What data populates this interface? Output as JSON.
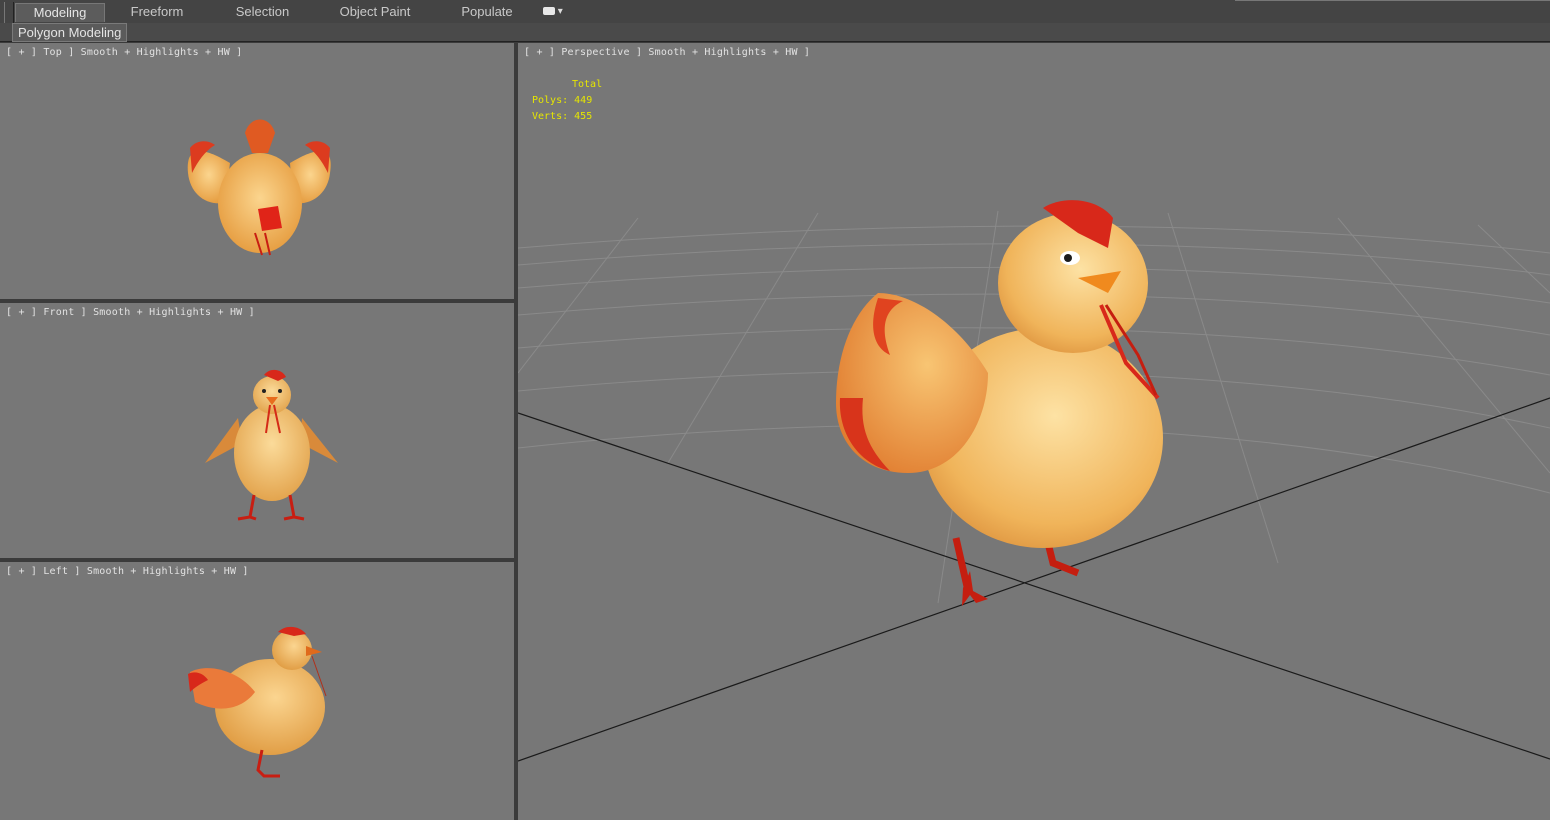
{
  "ribbon": {
    "tabs": [
      {
        "label": "Modeling",
        "active": true
      },
      {
        "label": "Freeform",
        "active": false
      },
      {
        "label": "Selection",
        "active": false
      },
      {
        "label": "Object Paint",
        "active": false
      },
      {
        "label": "Populate",
        "active": false
      }
    ],
    "panel_label": "Polygon Modeling"
  },
  "viewports": {
    "top": {
      "label": "[ + ] Top ] Smooth + Highlights + HW ]"
    },
    "front": {
      "label": "[ + ] Front ] Smooth + Highlights + HW ]"
    },
    "left": {
      "label": "[ + ] Left ] Smooth + Highlights + HW ]"
    },
    "perspective": {
      "label": "[ + ] Perspective ] Smooth + Highlights + HW ]"
    }
  },
  "stats": {
    "total_label": "Total",
    "polys_label": "Polys:",
    "polys_value": "449",
    "verts_label": "Verts:",
    "verts_value": "455"
  },
  "colors": {
    "viewport_bg": "#777777",
    "stats_text": "#e6e600",
    "chicken_body": "#f0b659",
    "chicken_red": "#d8281a"
  }
}
